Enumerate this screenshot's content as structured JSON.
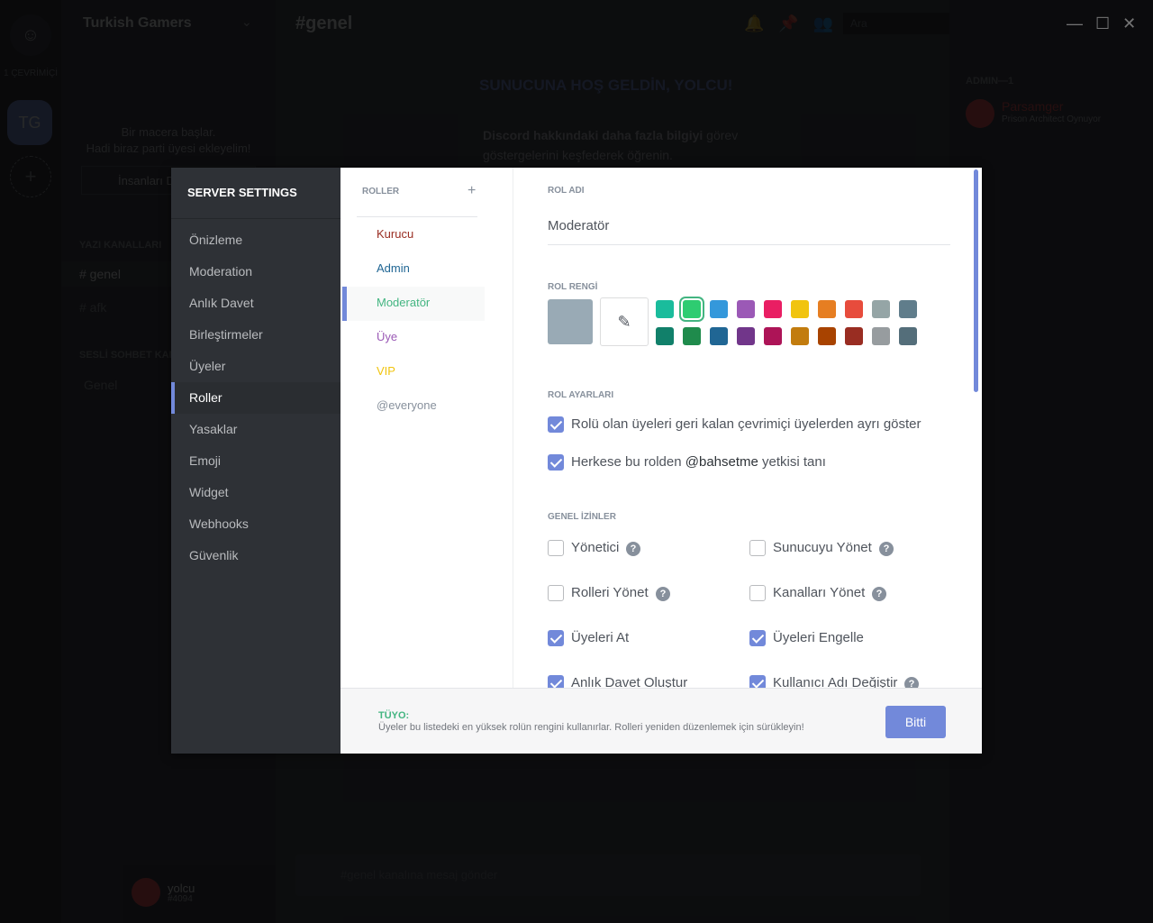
{
  "background": {
    "server_name": "Turkish Gamers",
    "guild_initials": "TG",
    "online_count": "1 ÇEVRİMİÇİ",
    "invite_title": "Bir macera başlar.",
    "invite_subtitle": "Hadi biraz parti üyesi ekleyelim!",
    "invite_button": "İnsanları Davet Et",
    "text_channels_header": "YAZI KANALLARI",
    "text_channels": [
      "# genel",
      "# afk"
    ],
    "voice_channels_header": "SESLİ SOHBET KANALLARI",
    "voice_channels": [
      "Genel"
    ],
    "channel_title": "#genel",
    "search_placeholder": "Ara",
    "welcome": "SUNUCUNA HOŞ GELDİN, YOLCU!",
    "info_bold": "Discord hakkındaki daha fazla bilgiyi",
    "info_rest": " görev göstergelerini keşfederek öğrenin.",
    "message_placeholder": "#genel kanalına mesaj gönder",
    "members_header": "ADMIN—1",
    "member_name": "Parsamger",
    "member_activity_game": "Prison Architect",
    "member_activity_status": "Oynuyor",
    "user_name": "yolcu",
    "user_tag": "#4094"
  },
  "settings": {
    "title": "SERVER SETTINGS",
    "nav": [
      {
        "label": "Önizleme",
        "active": false
      },
      {
        "label": "Moderation",
        "active": false
      },
      {
        "label": "Anlık Davet",
        "active": false
      },
      {
        "label": "Birleştirmeler",
        "active": false
      },
      {
        "label": "Üyeler",
        "active": false
      },
      {
        "label": "Roller",
        "active": true
      },
      {
        "label": "Yasaklar",
        "active": false
      },
      {
        "label": "Emoji",
        "active": false
      },
      {
        "label": "Widget",
        "active": false
      },
      {
        "label": "Webhooks",
        "active": false
      },
      {
        "label": "Güvenlik",
        "active": false
      }
    ]
  },
  "roles": {
    "header": "ROLLER",
    "add_icon": "plus-icon",
    "items": [
      {
        "label": "Kurucu",
        "color": "#992d22",
        "active": false
      },
      {
        "label": "Admin",
        "color": "#206694",
        "active": false
      },
      {
        "label": "Moderatör",
        "color": "#43b581",
        "active": true
      },
      {
        "label": "Üye",
        "color": "#9b59b6",
        "active": false
      },
      {
        "label": "VIP",
        "color": "#f1c40f",
        "active": false
      },
      {
        "label": "@everyone",
        "color": "#87909c",
        "active": false
      }
    ]
  },
  "editor": {
    "name_header": "ROL ADI",
    "name_value": "Moderatör",
    "color_header": "ROL RENGİ",
    "default_color": "#99aab5",
    "picker_icon": "eyedropper-icon",
    "swatches_row1": [
      "#1abc9c",
      "#2ecc71",
      "#3498db",
      "#9b59b6",
      "#e91e63",
      "#f1c40f",
      "#e67e22",
      "#e74c3c",
      "#95a5a6",
      "#607d8b"
    ],
    "swatches_row2": [
      "#11806a",
      "#1f8b4c",
      "#206694",
      "#71368a",
      "#ad1457",
      "#c27c0e",
      "#a84300",
      "#992d22",
      "#979c9f",
      "#546e7a"
    ],
    "selected_swatch": "#2ecc71",
    "settings_header": "ROL AYARLARI",
    "settings": [
      {
        "label": "Rolü olan üyeleri geri kalan çevrimiçi üyelerden ayrı göster",
        "checked": true
      },
      {
        "label_pre": "Herkese bu rolden ",
        "label_mention": "@bahsetme",
        "label_post": " yetkisi tanı",
        "checked": true
      }
    ],
    "permissions_header": "GENEL İZİNLER",
    "permissions": [
      {
        "label": "Yönetici",
        "checked": false,
        "help": true
      },
      {
        "label": "Sunucuyu Yönet",
        "checked": false,
        "help": true
      },
      {
        "label": "Rolleri Yönet",
        "checked": false,
        "help": true
      },
      {
        "label": "Kanalları Yönet",
        "checked": false,
        "help": true
      },
      {
        "label": "Üyeleri At",
        "checked": true,
        "help": false
      },
      {
        "label": "Üyeleri Engelle",
        "checked": true,
        "help": false
      },
      {
        "label": "Anlık Davet Oluştur",
        "checked": true,
        "help": false
      },
      {
        "label": "Kullanıcı Adı Değiştir",
        "checked": true,
        "help": true
      }
    ],
    "help_glyph": "?"
  },
  "footer": {
    "tip_title": "TÜYO:",
    "tip_text": "Üyeler bu listedeki en yüksek rolün rengini kullanırlar. Rolleri yeniden düzenlemek için sürükleyin!",
    "done_label": "Bitti"
  },
  "window_controls": {
    "minimize": "—",
    "maximize": "☐",
    "close": "✕"
  }
}
